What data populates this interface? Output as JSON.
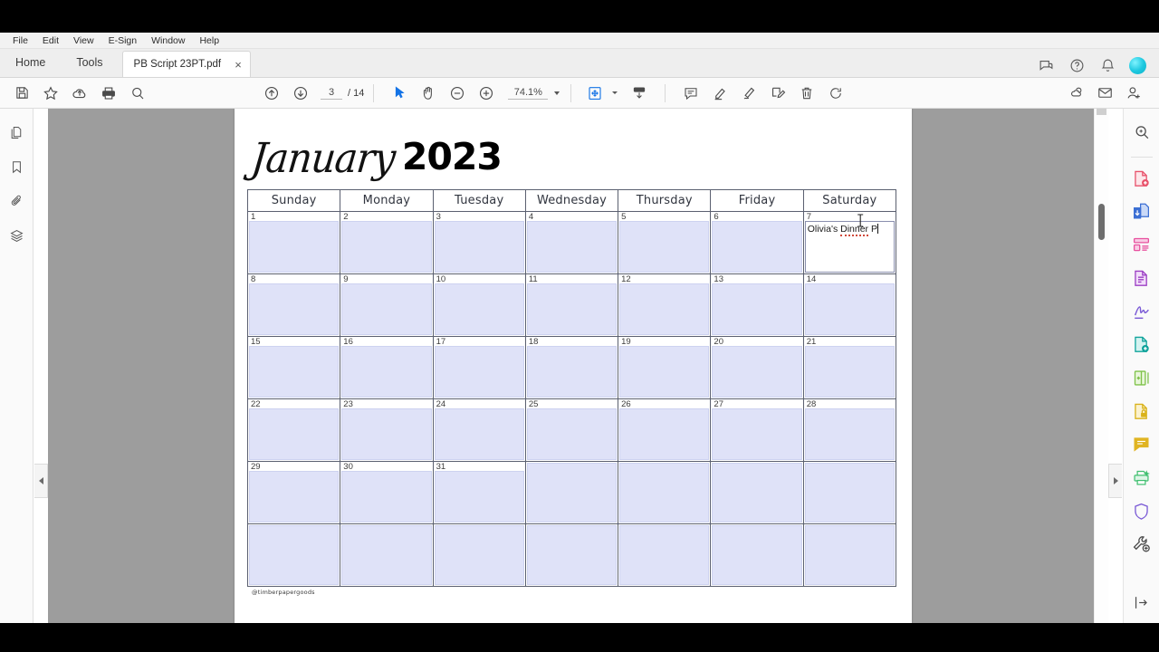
{
  "menu": {
    "items": [
      {
        "label": "File"
      },
      {
        "label": "Edit"
      },
      {
        "label": "View"
      },
      {
        "label": "E-Sign"
      },
      {
        "label": "Window"
      },
      {
        "label": "Help"
      }
    ]
  },
  "tabstrip": {
    "home_label": "Home",
    "tools_label": "Tools",
    "document_tab": {
      "title": "PB Script 23PT.pdf",
      "close_label": "×"
    },
    "right_icons": [
      "feedback-icon",
      "help-icon",
      "notification-bell-icon",
      "user-avatar"
    ]
  },
  "toolbar": {
    "left_icons": [
      "save-icon",
      "star-icon",
      "upload-cloud-icon",
      "print-icon",
      "zoom-search-icon"
    ],
    "page_prev_icon": "page-up-icon",
    "page_next_icon": "page-down-icon",
    "page_current": "3",
    "page_total": "/ 14",
    "select_icon": "select-cursor-icon",
    "hand_icon": "hand-tool-icon",
    "zoom_out_icon": "zoom-out-icon",
    "zoom_in_icon": "zoom-in-icon",
    "zoom_level": "74.1%",
    "fit_icon": "fit-page-icon",
    "download_icon": "download-icon",
    "annot_icons": [
      "comment-icon",
      "highlight-icon",
      "draw-icon",
      "sign-icon",
      "delete-icon",
      "rotate-icon"
    ],
    "right_icons": [
      "share-link-icon",
      "email-icon",
      "add-user-icon"
    ]
  },
  "left_rail": {
    "items": [
      {
        "icon": "page-thumbnails-icon"
      },
      {
        "icon": "bookmark-icon"
      },
      {
        "icon": "attachment-paperclip-icon"
      },
      {
        "icon": "layers-icon"
      }
    ]
  },
  "right_rail": {
    "items": [
      {
        "icon": "search-document-icon",
        "color": "#4a4a4a"
      },
      {
        "icon": "create-pdf-icon",
        "color": "#e8536c"
      },
      {
        "icon": "combine-files-icon",
        "color": "#3b6fd4"
      },
      {
        "icon": "organize-pages-icon",
        "color": "#e8519f"
      },
      {
        "icon": "edit-pdf-icon",
        "color": "#9c3fc4"
      },
      {
        "icon": "fill-and-sign-icon",
        "color": "#7b5bd6"
      },
      {
        "icon": "export-pdf-icon",
        "color": "#0fa39b"
      },
      {
        "icon": "compress-pdf-icon",
        "color": "#7fc24a"
      },
      {
        "icon": "protect-pdf-icon",
        "color": "#d9b21a"
      },
      {
        "icon": "comment-icon",
        "color": "#e0b422"
      },
      {
        "icon": "scan-ocr-icon",
        "color": "#3fbf6f"
      },
      {
        "icon": "shield-protect-icon",
        "color": "#7b5bd6"
      },
      {
        "icon": "more-tools-icon",
        "color": "#4a4a4a"
      },
      {
        "icon": "collapse-panel-icon",
        "color": "#4a4a4a"
      }
    ]
  },
  "document": {
    "month": "January",
    "year": "2023",
    "weekdays": [
      "Sunday",
      "Monday",
      "Tuesday",
      "Wednesday",
      "Thursday",
      "Friday",
      "Saturday"
    ],
    "weeks": [
      [
        "1",
        "2",
        "3",
        "4",
        "5",
        "6",
        "7"
      ],
      [
        "8",
        "9",
        "10",
        "11",
        "12",
        "13",
        "14"
      ],
      [
        "15",
        "16",
        "17",
        "18",
        "19",
        "20",
        "21"
      ],
      [
        "22",
        "23",
        "24",
        "25",
        "26",
        "27",
        "28"
      ],
      [
        "29",
        "30",
        "31",
        "",
        "",
        "",
        ""
      ],
      [
        "",
        "",
        "",
        "",
        "",
        "",
        ""
      ]
    ],
    "event": {
      "day": "7",
      "text_before": "Olivia's ",
      "text_misspelled": "Dinner",
      "text_after": " P"
    },
    "footer_handle": "@timberpapergoods"
  },
  "colors": {
    "form_field": "#dfe2f8",
    "grid_line": "#5b6070",
    "canvas_bg": "#9d9d9d",
    "accent_avatar": "#1ec8e0"
  }
}
